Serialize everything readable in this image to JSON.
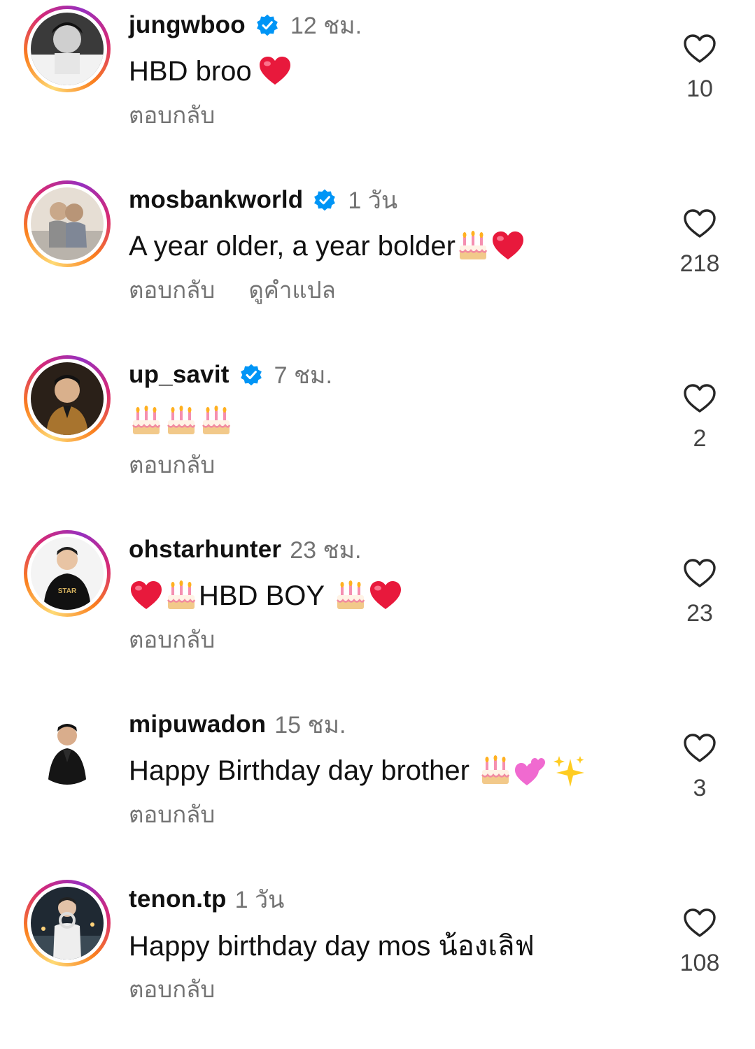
{
  "comments": [
    {
      "username": "jungwboo",
      "verified": true,
      "time": "12 ชม.",
      "text": "HBD broo",
      "emojis_after": [
        "red-heart"
      ],
      "actions": [
        "ตอบกลับ"
      ],
      "likes": "10",
      "story_ring": true
    },
    {
      "username": "mosbankworld",
      "verified": true,
      "time": "1 วัน",
      "text": "A year older, a year bolder",
      "emojis_after": [
        "birthday-cake",
        "red-heart"
      ],
      "actions": [
        "ตอบกลับ",
        "ดูคำแปล"
      ],
      "likes": "218",
      "story_ring": true
    },
    {
      "username": "up_savit",
      "verified": true,
      "time": "7 ชม.",
      "text": "",
      "emojis_after": [
        "birthday-cake",
        "birthday-cake",
        "birthday-cake"
      ],
      "actions": [
        "ตอบกลับ"
      ],
      "likes": "2",
      "story_ring": true
    },
    {
      "username": "ohstarhunter",
      "verified": false,
      "time": "23 ชม.",
      "text_before_emojis": [
        "red-heart",
        "birthday-cake"
      ],
      "text": "HBD BOY",
      "emojis_after": [
        "birthday-cake",
        "red-heart"
      ],
      "actions": [
        "ตอบกลับ"
      ],
      "likes": "23",
      "story_ring": true
    },
    {
      "username": "mipuwadon",
      "verified": false,
      "time": "15 ชม.",
      "text": "Happy Birthday day brother",
      "emojis_after": [
        "birthday-cake",
        "two-hearts",
        "sparkles"
      ],
      "actions": [
        "ตอบกลับ"
      ],
      "likes": "3",
      "story_ring": false
    },
    {
      "username": "tenon.tp",
      "verified": false,
      "time": "1 วัน",
      "text": "Happy birthday day mos น้องเลิฟ",
      "emojis_after": [],
      "actions": [
        "ตอบกลับ"
      ],
      "likes": "108",
      "story_ring": true
    }
  ],
  "colors": {
    "verified_blue": "#0095f6",
    "secondary_text": "#737373",
    "heart_red": "#e8193c"
  }
}
